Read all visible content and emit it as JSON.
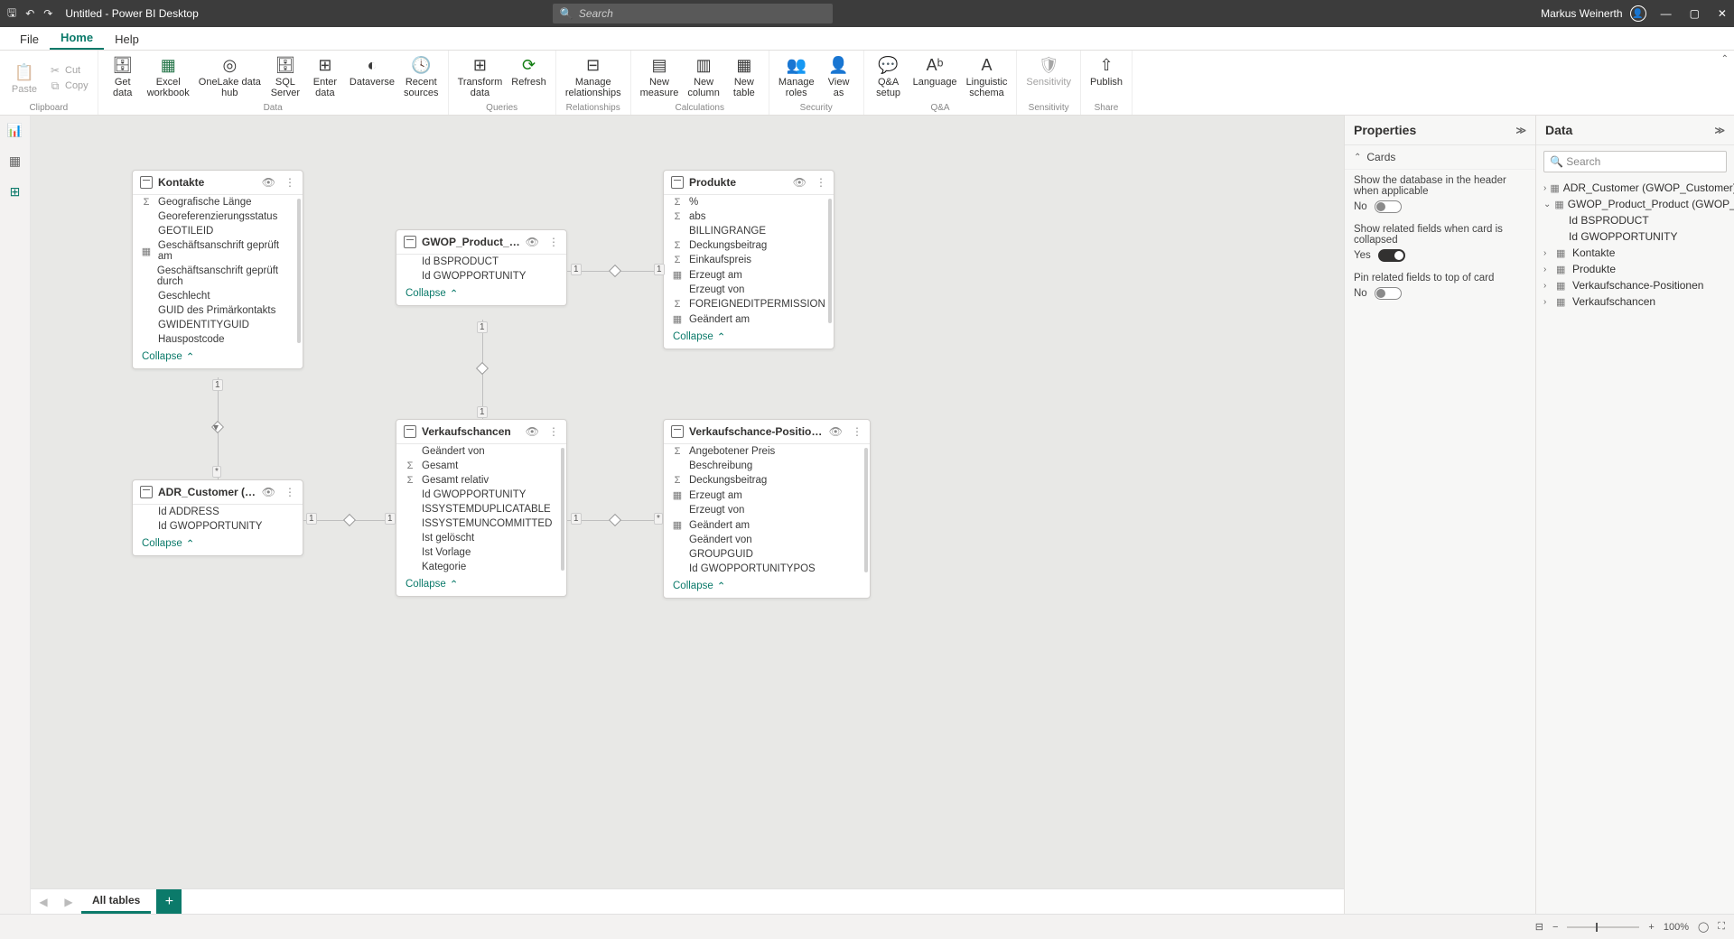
{
  "app": {
    "title": "Untitled - Power BI Desktop",
    "user": "Markus Weinerth",
    "search_placeholder": "Search"
  },
  "menu": {
    "file": "File",
    "home": "Home",
    "help": "Help"
  },
  "ribbon": {
    "clipboard": {
      "paste": "Paste",
      "cut": "Cut",
      "copy": "Copy",
      "label": "Clipboard"
    },
    "data": {
      "get_data": "Get\ndata",
      "excel": "Excel\nworkbook",
      "onelake": "OneLake data\nhub",
      "sql": "SQL\nServer",
      "enter": "Enter\ndata",
      "dataverse": "Dataverse",
      "recent": "Recent\nsources",
      "label": "Data"
    },
    "queries": {
      "transform": "Transform\ndata",
      "refresh": "Refresh",
      "label": "Queries"
    },
    "relationships": {
      "manage": "Manage\nrelationships",
      "label": "Relationships"
    },
    "calculations": {
      "measure": "New\nmeasure",
      "column": "New\ncolumn",
      "table": "New\ntable",
      "label": "Calculations"
    },
    "security": {
      "roles": "Manage\nroles",
      "view": "View\nas",
      "label": "Security"
    },
    "qa": {
      "setup": "Q&A\nsetup",
      "language": "Language",
      "linguistic": "Linguistic\nschema",
      "label": "Q&A"
    },
    "sensitivity": {
      "btn": "Sensitivity",
      "label": "Sensitivity"
    },
    "share": {
      "publish": "Publish",
      "label": "Share"
    }
  },
  "cards": {
    "kontakte": {
      "title": "Kontakte",
      "collapse": "Collapse",
      "fields": [
        {
          "icn": "Σ",
          "name": "Geografische Länge"
        },
        {
          "icn": "",
          "name": "Georeferenzierungsstatus"
        },
        {
          "icn": "",
          "name": "GEOTILEID"
        },
        {
          "icn": "▦",
          "name": "Geschäftsanschrift geprüft am"
        },
        {
          "icn": "",
          "name": "Geschäftsanschrift geprüft durch"
        },
        {
          "icn": "",
          "name": "Geschlecht"
        },
        {
          "icn": "",
          "name": "GUID des Primärkontakts"
        },
        {
          "icn": "",
          "name": "GWIDENTITYGUID"
        },
        {
          "icn": "",
          "name": "Hauspostcode"
        }
      ]
    },
    "gwop_prod": {
      "title": "GWOP_Product_Prod...",
      "collapse": "Collapse",
      "fields": [
        {
          "icn": "",
          "name": "Id BSPRODUCT"
        },
        {
          "icn": "",
          "name": "Id GWOPPORTUNITY"
        }
      ]
    },
    "produkte": {
      "title": "Produkte",
      "collapse": "Collapse",
      "fields": [
        {
          "icn": "Σ",
          "name": "%"
        },
        {
          "icn": "Σ",
          "name": "abs"
        },
        {
          "icn": "",
          "name": "BILLINGRANGE"
        },
        {
          "icn": "Σ",
          "name": "Deckungsbeitrag"
        },
        {
          "icn": "Σ",
          "name": "Einkaufspreis"
        },
        {
          "icn": "▦",
          "name": "Erzeugt am"
        },
        {
          "icn": "",
          "name": "Erzeugt von"
        },
        {
          "icn": "Σ",
          "name": "FOREIGNEDITPERMISSION"
        },
        {
          "icn": "▦",
          "name": "Geändert am"
        }
      ]
    },
    "adr_cust": {
      "title": "ADR_Customer (GWO...",
      "collapse": "Collapse",
      "fields": [
        {
          "icn": "",
          "name": "Id ADDRESS"
        },
        {
          "icn": "",
          "name": "Id GWOPPORTUNITY"
        }
      ]
    },
    "verkaufschancen": {
      "title": "Verkaufschancen",
      "collapse": "Collapse",
      "fields": [
        {
          "icn": "",
          "name": "Geändert von"
        },
        {
          "icn": "Σ",
          "name": "Gesamt"
        },
        {
          "icn": "Σ",
          "name": "Gesamt relativ"
        },
        {
          "icn": "",
          "name": "Id GWOPPORTUNITY"
        },
        {
          "icn": "",
          "name": "ISSYSTEMDUPLICATABLE"
        },
        {
          "icn": "",
          "name": "ISSYSTEMUNCOMMITTED"
        },
        {
          "icn": "",
          "name": "Ist gelöscht"
        },
        {
          "icn": "",
          "name": "Ist Vorlage"
        },
        {
          "icn": "",
          "name": "Kategorie"
        }
      ]
    },
    "verkaufschance_pos": {
      "title": "Verkaufschance-Positionen",
      "collapse": "Collapse",
      "fields": [
        {
          "icn": "Σ",
          "name": "Angebotener Preis"
        },
        {
          "icn": "",
          "name": "Beschreibung"
        },
        {
          "icn": "Σ",
          "name": "Deckungsbeitrag"
        },
        {
          "icn": "▦",
          "name": "Erzeugt am"
        },
        {
          "icn": "",
          "name": "Erzeugt von"
        },
        {
          "icn": "▦",
          "name": "Geändert am"
        },
        {
          "icn": "",
          "name": "Geändert von"
        },
        {
          "icn": "",
          "name": "GROUPGUID"
        },
        {
          "icn": "",
          "name": "Id GWOPPORTUNITYPOS"
        }
      ]
    }
  },
  "rel_labels": {
    "one": "1",
    "many": "*"
  },
  "properties": {
    "title": "Properties",
    "section_cards": "Cards",
    "show_db": "Show the database in the header when applicable",
    "show_related": "Show related fields when card is collapsed",
    "pin_related": "Pin related fields to top of card",
    "no": "No",
    "yes": "Yes"
  },
  "data_pane": {
    "title": "Data",
    "search": "Search",
    "items": [
      {
        "type": "t",
        "name": "ADR_Customer (GWOP_Customer)",
        "open": false
      },
      {
        "type": "t",
        "name": "GWOP_Product_Product (GWOP_Product)",
        "open": true
      },
      {
        "type": "f",
        "name": "Id BSPRODUCT"
      },
      {
        "type": "f",
        "name": "Id GWOPPORTUNITY"
      },
      {
        "type": "t",
        "name": "Kontakte",
        "open": false
      },
      {
        "type": "t",
        "name": "Produkte",
        "open": false
      },
      {
        "type": "t",
        "name": "Verkaufschance-Positionen",
        "open": false
      },
      {
        "type": "t",
        "name": "Verkaufschancen",
        "open": false
      }
    ]
  },
  "tabs": {
    "all_tables": "All tables"
  },
  "status": {
    "zoom": "100%"
  }
}
